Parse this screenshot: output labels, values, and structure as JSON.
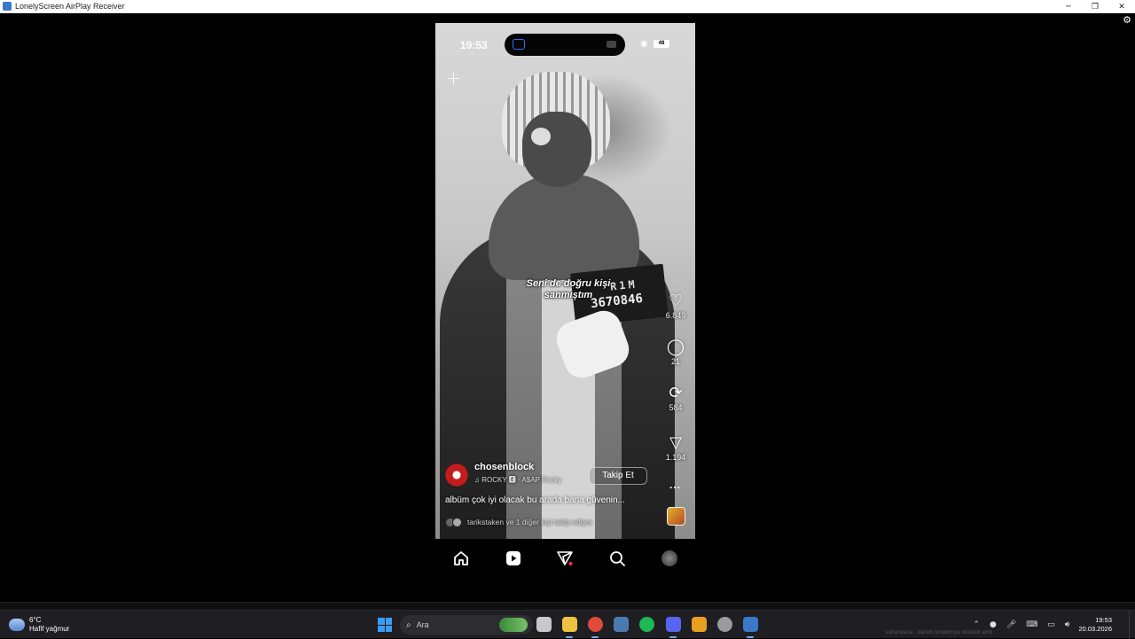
{
  "window": {
    "title": "LonelyScreen AirPlay Receiver",
    "minimize": "─",
    "restore": "❐",
    "close": "✕",
    "settings_icon": "gear-icon"
  },
  "phone": {
    "status": {
      "time": "19:53",
      "battery": "48",
      "wifi_icon": "wifi-icon"
    },
    "plus": "+",
    "placard": {
      "line1": "R1M",
      "line2": "3670846"
    },
    "caption": "Seni de doğru kişi sanmıştım",
    "actions": {
      "likes": "6.849",
      "comments": "21",
      "reposts": "584",
      "shares": "1.194"
    },
    "author": {
      "username": "chosenblock",
      "music": "♫  ROCKY  🅴 · A$AP Rocky",
      "follow": "Takip Et",
      "more": "..."
    },
    "description": "albüm çok iyi olacak bu arada bana güvenin...",
    "followers_text": "tarikstaken ve 1 diğer kişi takip ediyor",
    "nav": [
      "home-icon",
      "reels-icon",
      "messages-icon",
      "search-icon",
      "profile-avatar"
    ]
  },
  "taskbar": {
    "weather": {
      "temp": "6°C",
      "condition": "Hafif yağmur"
    },
    "search": {
      "placeholder": "Ara"
    },
    "apps": [
      {
        "name": "task-view",
        "color": "#c8c8cc"
      },
      {
        "name": "file-explorer",
        "color": "#f0c040"
      },
      {
        "name": "chrome",
        "color": "#e04a3a"
      },
      {
        "name": "steam",
        "color": "#4a7ab0"
      },
      {
        "name": "spotify",
        "color": "#1db954"
      },
      {
        "name": "discord",
        "color": "#5865f2"
      },
      {
        "name": "app-pen",
        "color": "#e8a020"
      },
      {
        "name": "app-ball",
        "color": "#9a9aa0"
      },
      {
        "name": "lonelyscreen",
        "color": "#3a78c8"
      }
    ],
    "tray_note": "sahankaca : benim bırakmıya düzeldi amk",
    "clock": {
      "time": "19:53",
      "date": "20.03.2026"
    }
  }
}
